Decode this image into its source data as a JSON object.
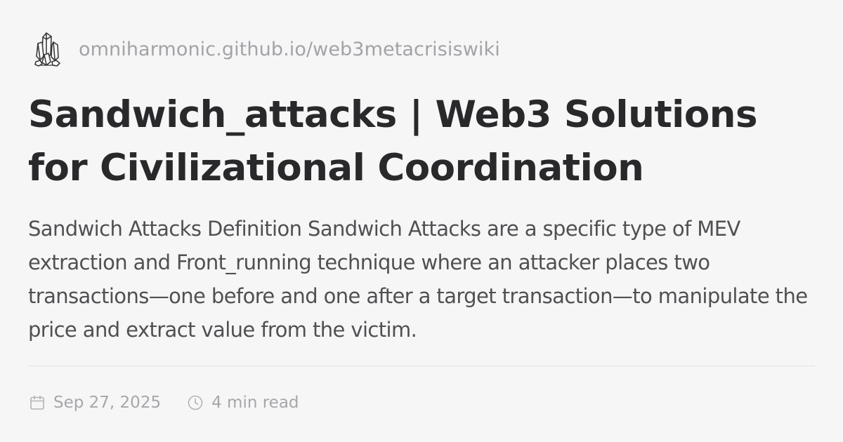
{
  "site": {
    "logo_icon": "crystal-cluster-icon",
    "url": "omniharmonic.github.io/web3metacrisiswiki"
  },
  "article": {
    "title": "Sandwich_attacks | Web3 Solutions for Civilizational Coordination",
    "description": "Sandwich Attacks Definition Sandwich Attacks are a specific type of MEV extraction and Front_running technique where an attacker places two transactions—one before and one after a target transaction—to manipulate the price and extract value from the victim."
  },
  "meta": {
    "date_icon": "calendar-icon",
    "date": "Sep 27, 2025",
    "read_time_icon": "clock-icon",
    "read_time": "4 min read"
  },
  "colors": {
    "background": "#f6f6f7",
    "title": "#29292b",
    "body_text": "#505053",
    "muted_text": "#a3a3a7",
    "divider": "#e2e2e5"
  }
}
